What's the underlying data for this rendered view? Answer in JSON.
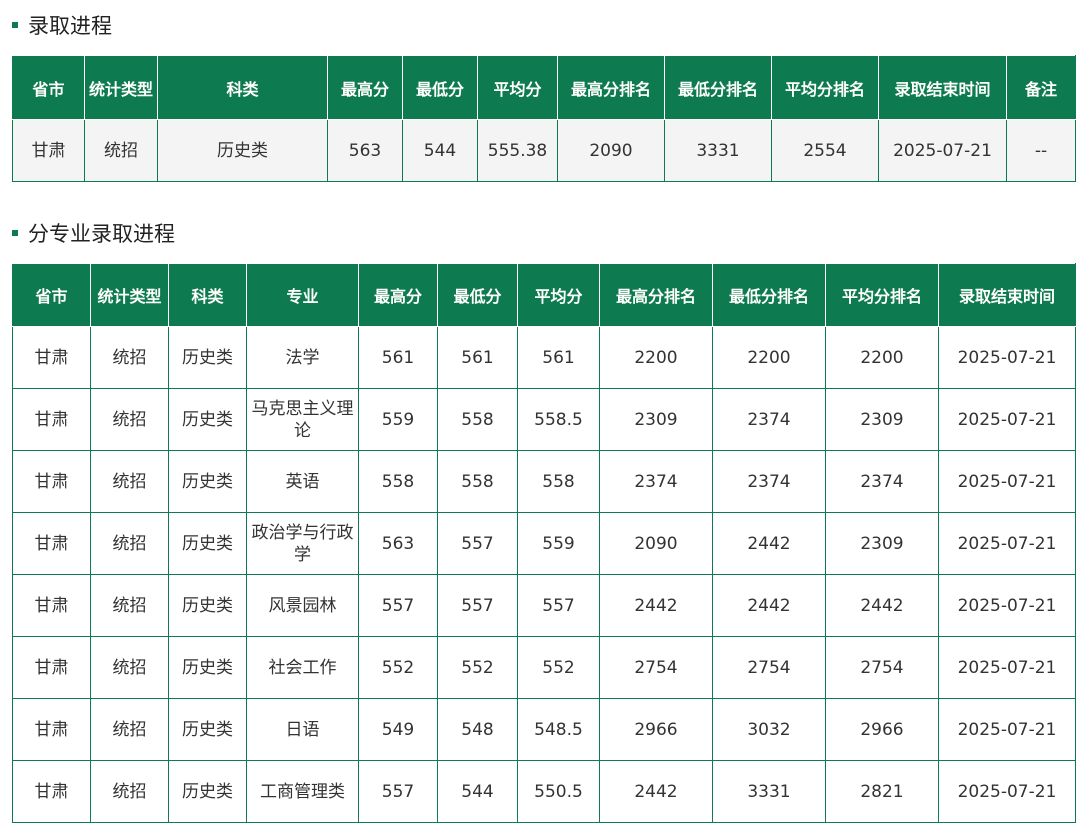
{
  "section1": {
    "title": "录取进程",
    "headers": [
      "省市",
      "统计类型",
      "科类",
      "最高分",
      "最低分",
      "平均分",
      "最高分排名",
      "最低分排名",
      "平均分排名",
      "录取结束时间",
      "备注"
    ],
    "rows": [
      [
        "甘肃",
        "统招",
        "历史类",
        "563",
        "544",
        "555.38",
        "2090",
        "3331",
        "2554",
        "2025-07-21",
        "--"
      ]
    ]
  },
  "section2": {
    "title": "分专业录取进程",
    "headers": [
      "省市",
      "统计类型",
      "科类",
      "专业",
      "最高分",
      "最低分",
      "平均分",
      "最高分排名",
      "最低分排名",
      "平均分排名",
      "录取结束时间"
    ],
    "rows": [
      [
        "甘肃",
        "统招",
        "历史类",
        "法学",
        "561",
        "561",
        "561",
        "2200",
        "2200",
        "2200",
        "2025-07-21"
      ],
      [
        "甘肃",
        "统招",
        "历史类",
        "马克思主义理论",
        "559",
        "558",
        "558.5",
        "2309",
        "2374",
        "2309",
        "2025-07-21"
      ],
      [
        "甘肃",
        "统招",
        "历史类",
        "英语",
        "558",
        "558",
        "558",
        "2374",
        "2374",
        "2374",
        "2025-07-21"
      ],
      [
        "甘肃",
        "统招",
        "历史类",
        "政治学与行政学",
        "563",
        "557",
        "559",
        "2090",
        "2442",
        "2309",
        "2025-07-21"
      ],
      [
        "甘肃",
        "统招",
        "历史类",
        "风景园林",
        "557",
        "557",
        "557",
        "2442",
        "2442",
        "2442",
        "2025-07-21"
      ],
      [
        "甘肃",
        "统招",
        "历史类",
        "社会工作",
        "552",
        "552",
        "552",
        "2754",
        "2754",
        "2754",
        "2025-07-21"
      ],
      [
        "甘肃",
        "统招",
        "历史类",
        "日语",
        "549",
        "548",
        "548.5",
        "2966",
        "3032",
        "2966",
        "2025-07-21"
      ],
      [
        "甘肃",
        "统招",
        "历史类",
        "工商管理类",
        "557",
        "544",
        "550.5",
        "2442",
        "3331",
        "2821",
        "2025-07-21"
      ]
    ]
  },
  "colors": {
    "header_bg": "#0e7a4f",
    "border": "#0e7a4f"
  }
}
